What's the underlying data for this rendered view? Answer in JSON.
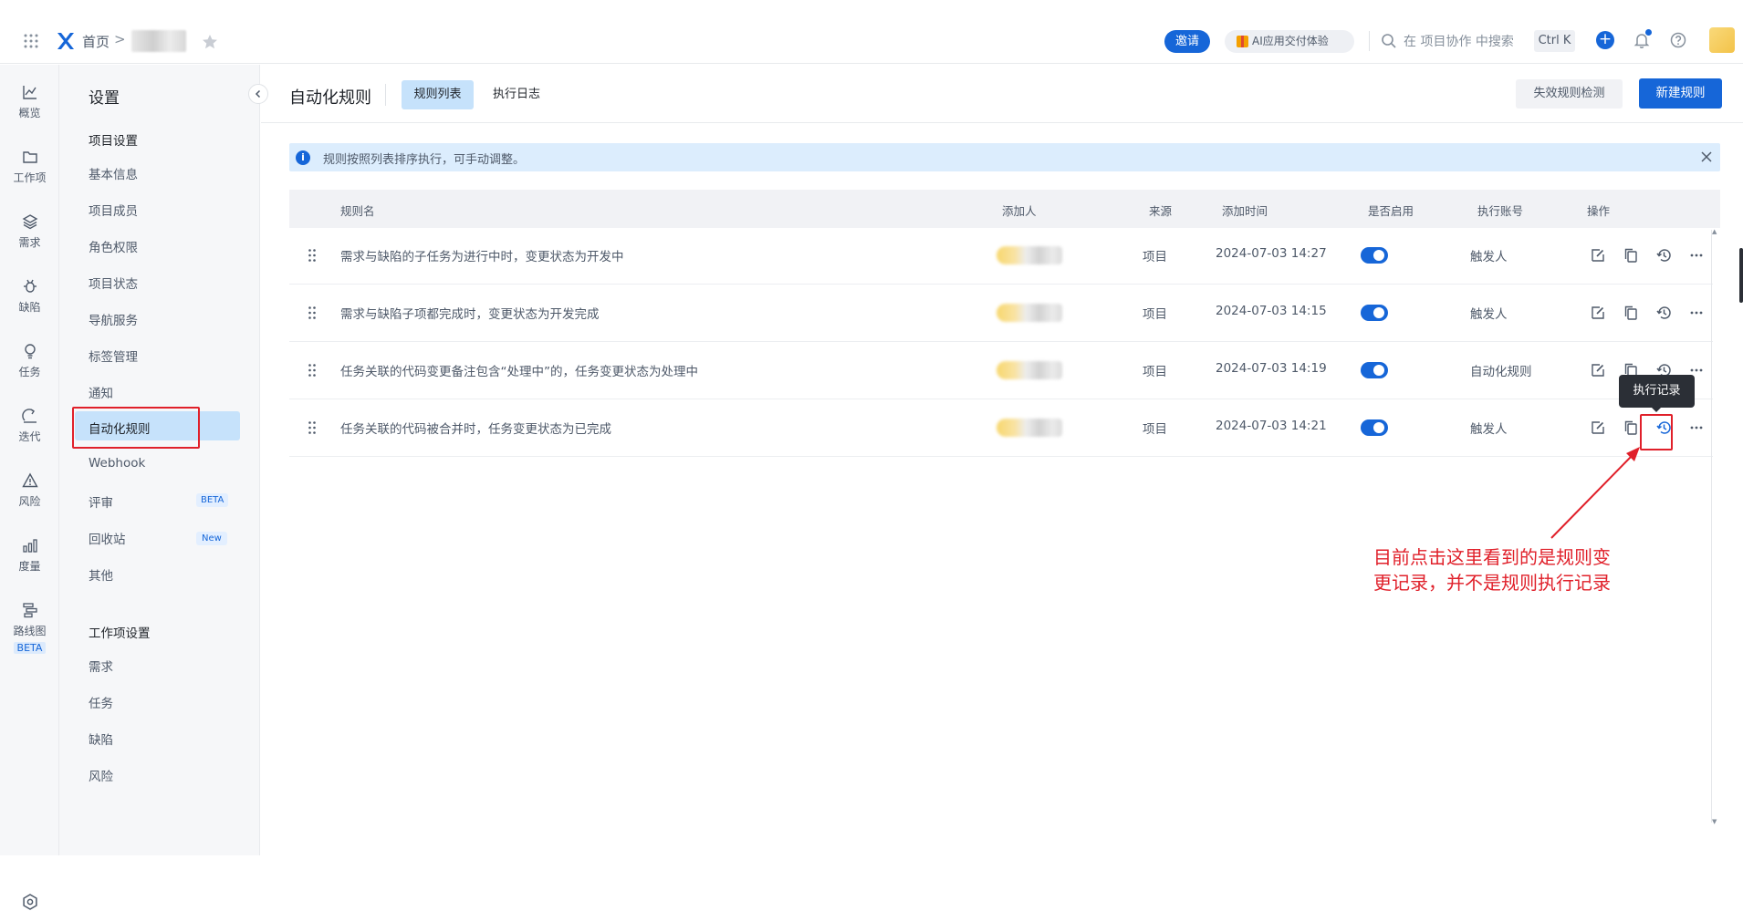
{
  "topbar": {
    "home_label": "首页",
    "crumb_separator": ">",
    "invite_label": "邀请",
    "ai_label": "AI应用交付体验",
    "search_placeholder": "在 项目协作 中搜索",
    "shortcut": "Ctrl K",
    "plus_glyph": "+",
    "icons": [
      "apps-grid-icon",
      "logo-icon",
      "star-icon",
      "gift-icon",
      "search-icon",
      "plus-icon",
      "bell-icon",
      "help-icon"
    ]
  },
  "left_nav": {
    "items": [
      {
        "label": "概览",
        "icon": "chart-line-icon"
      },
      {
        "label": "工作项",
        "icon": "folder-icon"
      },
      {
        "label": "需求",
        "icon": "layers-icon"
      },
      {
        "label": "缺陷",
        "icon": "bug-icon"
      },
      {
        "label": "任务",
        "icon": "bulb-icon"
      },
      {
        "label": "迭代",
        "icon": "cycle-icon"
      },
      {
        "label": "风险",
        "icon": "warning-icon"
      },
      {
        "label": "度量",
        "icon": "bar-chart-icon"
      },
      {
        "label": "路线图",
        "icon": "roadmap-icon",
        "badge": "BETA"
      }
    ]
  },
  "settings": {
    "title": "设置",
    "project_group": "项目设置",
    "project_items": [
      "基本信息",
      "项目成员",
      "角色权限",
      "项目状态",
      "导航服务",
      "标签管理",
      "通知",
      "自动化规则",
      "Webhook",
      "评审",
      "回收站",
      "其他"
    ],
    "active_item": "自动化规则",
    "review_badge": "BETA",
    "recycle_badge": "New",
    "workitem_group": "工作项设置",
    "workitem_items": [
      "需求",
      "任务",
      "缺陷",
      "风险"
    ]
  },
  "main": {
    "title": "自动化规则",
    "tabs": [
      "规则列表",
      "执行日志"
    ],
    "active_tab": "规则列表",
    "check_button": "失效规则检测",
    "new_button": "新建规则",
    "notice": "规则按照列表排序执行，可手动调整。",
    "notice_icon": "i"
  },
  "table": {
    "columns": [
      "规则名",
      "添加人",
      "来源",
      "添加时间",
      "是否启用",
      "执行账号",
      "操作"
    ],
    "rows": [
      {
        "name": "需求与缺陷的子任务为进行中时，变更状态为开发中",
        "source": "项目",
        "time": "2024-07-03 14:27",
        "enabled": true,
        "account": "触发人"
      },
      {
        "name": "需求与缺陷子项都完成时，变更状态为开发完成",
        "source": "项目",
        "time": "2024-07-03 14:15",
        "enabled": true,
        "account": "触发人"
      },
      {
        "name": "任务关联的代码变更备注包含“处理中”的，任务变更状态为处理中",
        "source": "项目",
        "time": "2024-07-03 14:19",
        "enabled": true,
        "account": "自动化规则"
      },
      {
        "name": "任务关联的代码被合并时，任务变更状态为已完成",
        "source": "项目",
        "time": "2024-07-03 14:21",
        "enabled": true,
        "account": "触发人"
      }
    ],
    "action_icons": [
      "edit-icon",
      "copy-icon",
      "history-icon",
      "more-icon"
    ]
  },
  "tooltip": "执行记录",
  "annotation": {
    "line1": "目前点击这里看到的是规则变",
    "line2": "更记录，并不是规则执行记录",
    "color": "#e0202a"
  },
  "colors": {
    "primary": "#1666d8",
    "active_bg": "#c6e2fb",
    "notice_bg": "#dcedfd"
  }
}
